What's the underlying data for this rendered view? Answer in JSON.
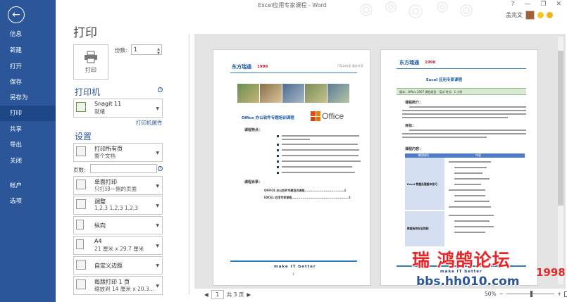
{
  "window": {
    "title": "Excel应用专家课程 - Word",
    "controls": [
      "?",
      "—",
      "❐",
      "✕"
    ],
    "user_name": "孟兆文"
  },
  "nav": {
    "back_label": "←",
    "items": [
      {
        "label": "信息"
      },
      {
        "label": "新建"
      },
      {
        "label": "打开"
      },
      {
        "label": "保存"
      },
      {
        "label": "另存为"
      },
      {
        "label": "打印"
      },
      {
        "label": "共享"
      },
      {
        "label": "导出"
      },
      {
        "label": "关闭"
      },
      {
        "label": "帐户"
      },
      {
        "label": "选项"
      }
    ],
    "active": "打印"
  },
  "print": {
    "title": "打印",
    "print_button_label": "打印",
    "copies_label": "份数:",
    "copies_value": "1"
  },
  "printer": {
    "section_title": "打印机",
    "name": "Snagit 11",
    "status": "就绪",
    "properties_link": "打印机属性"
  },
  "settings": {
    "section_title": "设置",
    "pages_label": "页数:",
    "pages_value": "",
    "dropdowns": [
      {
        "line1": "打印所有页",
        "line2": "整个文档"
      },
      {
        "line1": "单面打印",
        "line2": "只打印一侧的页面"
      },
      {
        "line1": "调整",
        "line2": "1,2,3    1,2,3    1,2,3"
      },
      {
        "line1": "纵向",
        "line2": ""
      },
      {
        "line1": "A4",
        "line2": "21 厘米 x 29.7 厘米"
      },
      {
        "line1": "自定义边距",
        "line2": ""
      },
      {
        "line1": "每版打印 1 页",
        "line2": "缩放到 14 厘米 x 20.3..."
      }
    ]
  },
  "preview": {
    "page1": {
      "brand": "东方瑞通",
      "brand_year": "1998",
      "header_note": "IT培训专家 服务专家",
      "course_title": "Office 办公软件专题培训课程",
      "office_word": "Office",
      "section1": "课程特点：",
      "section2": "课程目录：",
      "toc1": "OFFICE 办公软件专题培训课程.....................................1",
      "toc2": "EXCEL 应用专家课程.....................................................1",
      "footer": "make IT better",
      "page_number": "1"
    },
    "page2": {
      "brand": "东方瑞通",
      "brand_year": "1998",
      "course_title": "Excel 应用专家课程",
      "info_bar": "版本：Office 2007        课程类型：培训        时长：1 小时",
      "section1": "课程简介：",
      "section2": "目标：",
      "section3": "课程内容：",
      "table_header1": "课程模块",
      "table_header2": "内容",
      "row1": "Excel 数据处理基本技巧",
      "row2": "数据有效安全控制",
      "footer": "make IT better"
    }
  },
  "bottom": {
    "page_current": "1",
    "page_total": "共 3 页",
    "zoom": "50%"
  },
  "watermark": {
    "logo": "瑞 鸿鹄论坛",
    "year": "1998",
    "url": "bbs.hh010.com"
  },
  "colors": {
    "nav_bg": "#2b579a",
    "nav_active": "#1e4788",
    "accent": "#2b579a",
    "watermark_red": "#e8262a"
  }
}
